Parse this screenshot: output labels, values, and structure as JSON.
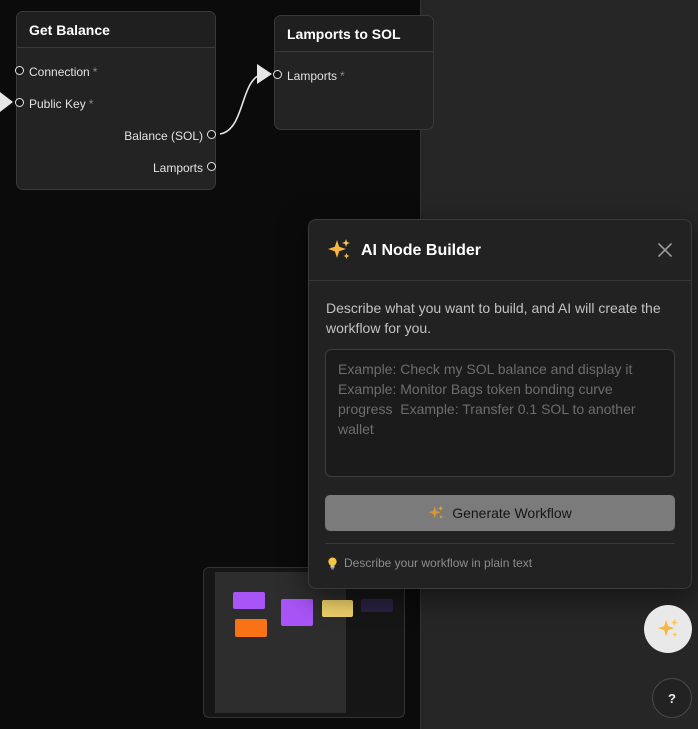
{
  "nodes": {
    "get_balance": {
      "title": "Get Balance",
      "inputs": [
        {
          "label": "Connection",
          "required_mark": "*"
        },
        {
          "label": "Public Key",
          "required_mark": "*"
        }
      ],
      "outputs": [
        {
          "label": "Balance (SOL)"
        },
        {
          "label": "Lamports"
        }
      ]
    },
    "lamports_to_sol": {
      "title": "Lamports to SOL",
      "inputs": [
        {
          "label": "Lamports",
          "required_mark": "*"
        }
      ]
    }
  },
  "ai_modal": {
    "title": "AI Node Builder",
    "title_icon": "sparkles-icon",
    "close_icon": "close-icon",
    "description": "Describe what you want to build, and AI will create the workflow for you.",
    "prompt_value": "",
    "prompt_placeholder": "Example: Check my SOL balance and display it\nExample: Monitor Bags token bonding curve progress  Example: Transfer 0.1 SOL to another wallet",
    "generate_label": "Generate Workflow",
    "tip_icon": "lightbulb-icon",
    "tip": "Describe your workflow in plain text"
  },
  "minimap": {
    "block_colors": [
      "#a855f7",
      "#a855f7",
      "#f97316",
      "#f0d36b",
      "#2a2140"
    ]
  },
  "floating": {
    "ai_icon": "sparkles-icon",
    "help_label": "?"
  },
  "colors": {
    "canvas_bg": "#0b0b0b",
    "panel_bg": "#262626",
    "node_bg": "#232323",
    "accent_purple": "#a855f7",
    "accent_orange": "#f97316",
    "accent_yellow": "#f0d36b",
    "sparkle_gold": "#f5b642"
  }
}
